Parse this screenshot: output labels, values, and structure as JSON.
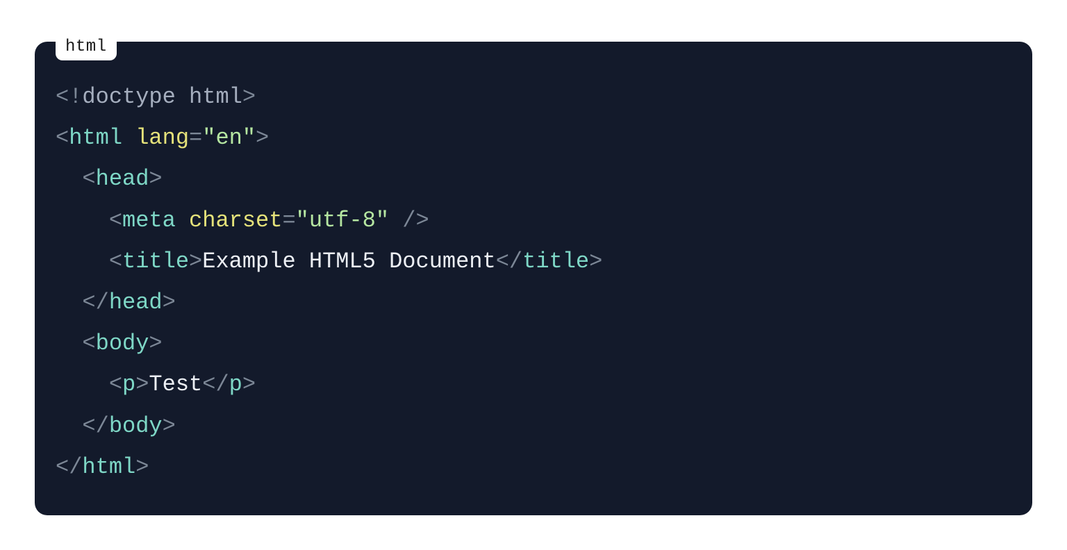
{
  "language_label": "html",
  "code": {
    "line1": {
      "open_angle_bang": "<!",
      "doctype": "doctype html",
      "close_angle": ">"
    },
    "line2": {
      "open_angle": "<",
      "tag": "html",
      "space": " ",
      "attr": "lang",
      "eq": "=",
      "str": "\"en\"",
      "close_angle": ">"
    },
    "line3": {
      "indent": "  ",
      "open_angle": "<",
      "tag": "head",
      "close_angle": ">"
    },
    "line4": {
      "indent": "    ",
      "open_angle": "<",
      "tag": "meta",
      "space": " ",
      "attr": "charset",
      "eq": "=",
      "str": "\"utf-8\"",
      "self_close": " />"
    },
    "line5": {
      "indent": "    ",
      "open_angle": "<",
      "tag": "title",
      "close_angle": ">",
      "text": "Example HTML5 Document",
      "open_angle_close": "</",
      "tag_close": "title",
      "close_angle2": ">"
    },
    "line6": {
      "indent": "  ",
      "open_angle_close": "</",
      "tag": "head",
      "close_angle": ">"
    },
    "line7": {
      "indent": "  ",
      "open_angle": "<",
      "tag": "body",
      "close_angle": ">"
    },
    "line8": {
      "indent": "    ",
      "open_angle": "<",
      "tag": "p",
      "close_angle": ">",
      "text": "Test",
      "open_angle_close": "</",
      "tag_close": "p",
      "close_angle2": ">"
    },
    "line9": {
      "indent": "  ",
      "open_angle_close": "</",
      "tag": "body",
      "close_angle": ">"
    },
    "line10": {
      "open_angle_close": "</",
      "tag": "html",
      "close_angle": ">"
    }
  }
}
